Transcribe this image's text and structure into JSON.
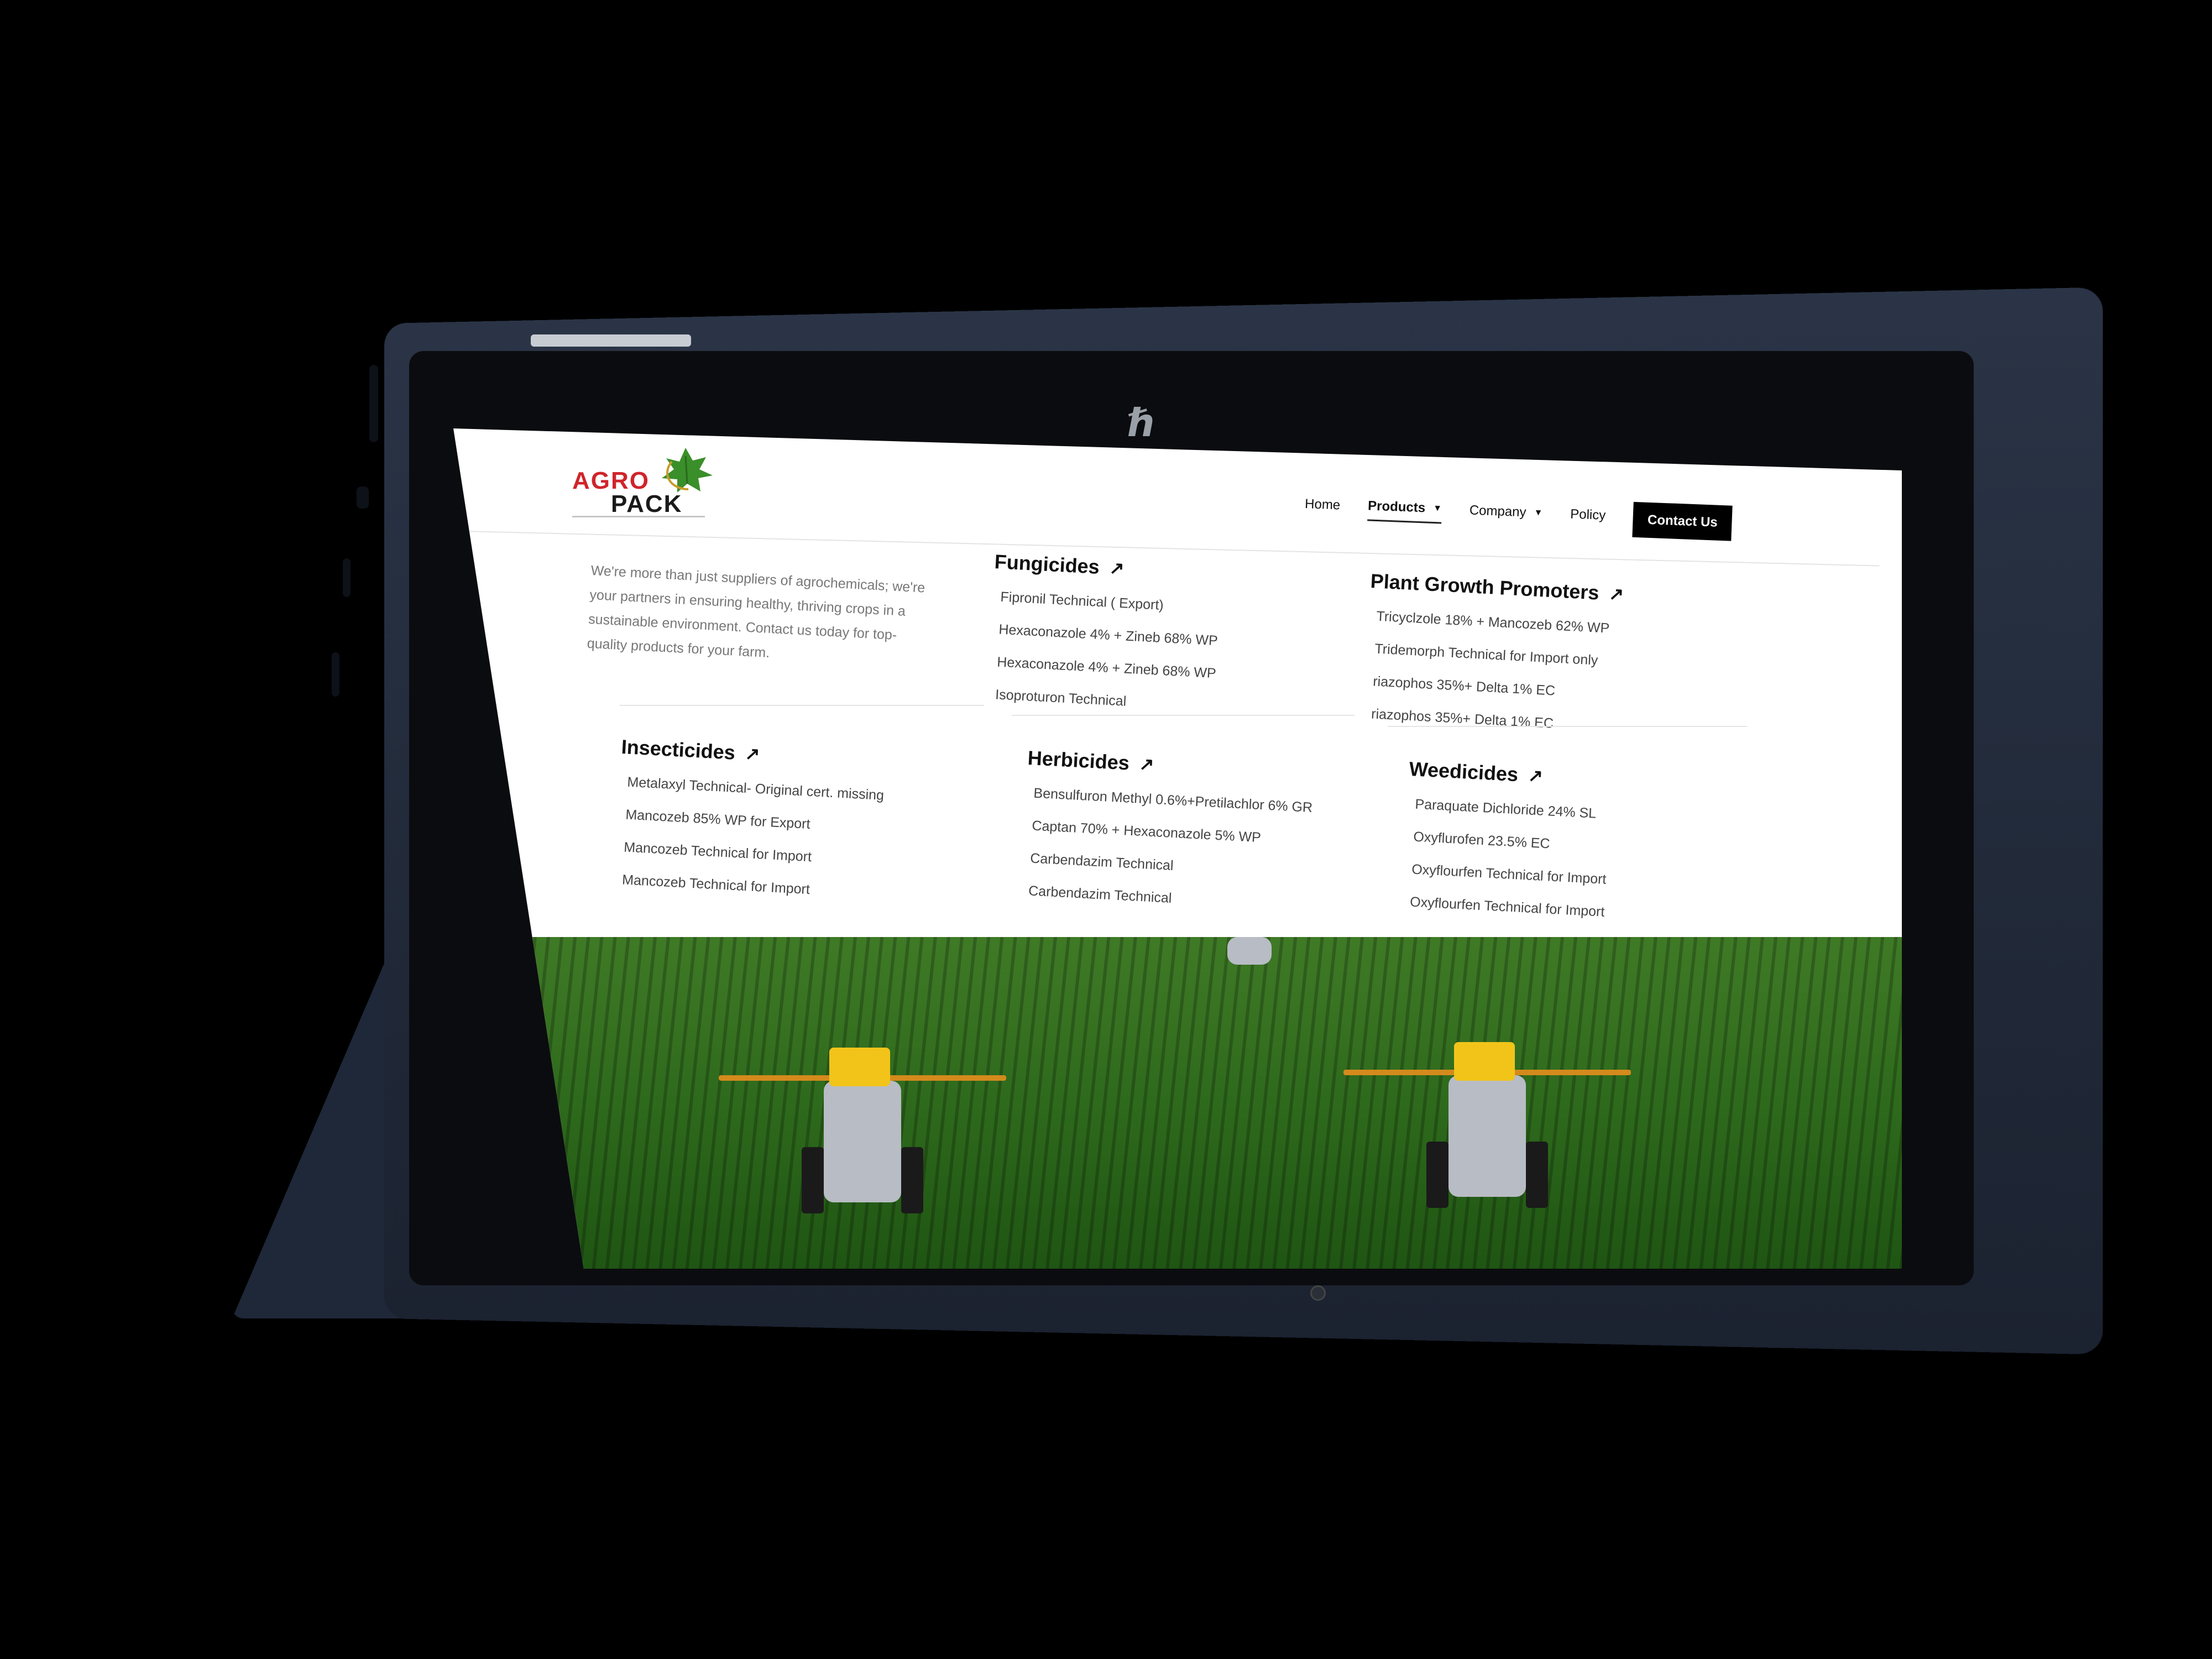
{
  "brand": {
    "logo_line1": "AGRO",
    "logo_line2": "PACK"
  },
  "nav": {
    "items": [
      {
        "label": "Home",
        "has_caret": false,
        "active": false
      },
      {
        "label": "Products",
        "has_caret": true,
        "active": true
      },
      {
        "label": "Company",
        "has_caret": true,
        "active": false
      },
      {
        "label": "Policy",
        "has_caret": false,
        "active": false
      }
    ],
    "contact_label": "Contact Us",
    "caret_glyph": "▼"
  },
  "intro": "We're more than just suppliers of agrochemicals; we're your partners in ensuring healthy, thriving crops in a sustainable environment. Contact us today for top-quality products for your farm.",
  "categories": {
    "fungicides": {
      "title": "Fungicides",
      "items": [
        "Fipronil Technical ( Export)",
        "Hexaconazole 4% + Zineb 68% WP",
        "Hexaconazole 4% + Zineb 68% WP",
        "Isoproturon Technical"
      ]
    },
    "plant_growth": {
      "title": "Plant Growth Promoters",
      "items": [
        "Tricyclzole 18% + Mancozeb 62% WP",
        "Tridemorph Technical for Import only",
        "riazophos 35%+ Delta 1% EC",
        "riazophos 35%+ Delta 1% EC"
      ]
    },
    "insecticides": {
      "title": "Insecticides",
      "items": [
        "Metalaxyl Technical- Original cert. missing",
        "Mancozeb 85% WP for Export",
        "Mancozeb Technical for Import",
        "Mancozeb Technical for Import"
      ]
    },
    "herbicides": {
      "title": "Herbicides",
      "items": [
        "Bensulfuron Methyl 0.6%+Pretilachlor 6% GR",
        "Captan 70% + Hexaconazole 5% WP",
        "Carbendazim Technical",
        "Carbendazim Technical"
      ]
    },
    "weedicides": {
      "title": "Weedicides",
      "items": [
        "Paraquate Dichloride 24% SL",
        "Oxyflurofen 23.5% EC",
        "Oxyflourfen Technical for Import",
        "Oxyflourfen Technical for Import"
      ]
    }
  },
  "icons": {
    "arrow": "↗",
    "device_brand": "hp-logo-icon"
  },
  "colors": {
    "brand_red": "#d0242b",
    "button_bg": "#000000",
    "field_green": "#2e6a1c",
    "device_body": "#1e2838"
  }
}
